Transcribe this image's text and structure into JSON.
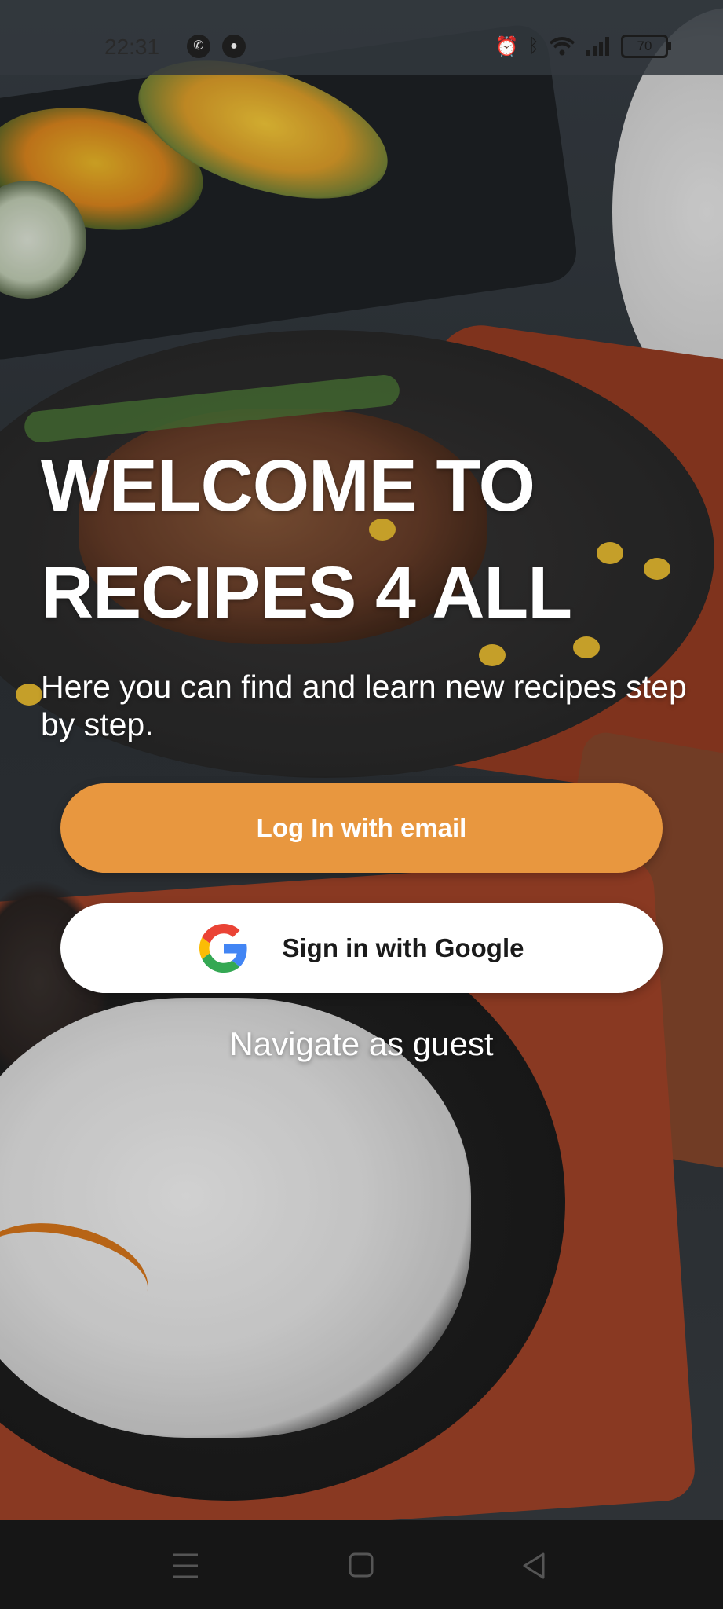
{
  "status_bar": {
    "time": "22:31",
    "left_icons": [
      "whatsapp-icon",
      "notification-icon"
    ],
    "right_icons": [
      "alarm-icon",
      "bluetooth-icon",
      "wifi-icon",
      "signal-icon"
    ],
    "battery": "70"
  },
  "welcome": {
    "title_line1": "WELCOME TO",
    "title_line2": "RECIPES 4 ALL",
    "subtitle": "Here you can find and learn new recipes step by step."
  },
  "actions": {
    "email_login_label": "Log In with email",
    "google_login_label": "Sign in with Google",
    "guest_label": "Navigate as guest"
  },
  "colors": {
    "accent": "#e8973f",
    "google_button_bg": "#ffffff",
    "nav_bar_bg": "#161616"
  },
  "nav_bar": {
    "icons": [
      "menu-icon",
      "home-icon",
      "back-icon"
    ]
  }
}
